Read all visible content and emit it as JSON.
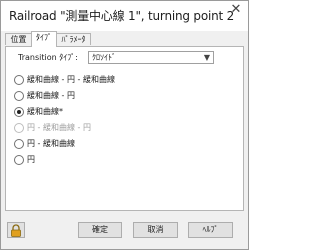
{
  "window": {
    "title": "Railroad \"測量中心線 1\", turning point 2",
    "close_glyph": "✕"
  },
  "tabs": [
    {
      "label": "位置"
    },
    {
      "label": "ﾀｲﾌﾟ"
    },
    {
      "label": "ﾊﾟﾗﾒｰﾀ"
    }
  ],
  "active_tab": 1,
  "type_tab": {
    "transition_label": "Transition ﾀｲﾌﾟ:",
    "transition_value": "ｸﾛｿｲﾄﾞ",
    "options": [
      {
        "label": "緩和曲線 - 円 - 緩和曲線",
        "checked": false,
        "disabled": false
      },
      {
        "label": "緩和曲線 - 円",
        "checked": false,
        "disabled": false
      },
      {
        "label": "緩和曲線*",
        "checked": true,
        "disabled": false
      },
      {
        "label": "円 - 緩和曲線 - 円",
        "checked": false,
        "disabled": true
      },
      {
        "label": "円 - 緩和曲線",
        "checked": false,
        "disabled": false
      },
      {
        "label": "円",
        "checked": false,
        "disabled": false
      }
    ]
  },
  "footer": {
    "ok_label": "確定",
    "cancel_label": "取消",
    "help_label": "ﾍﾙﾌﾟ",
    "lock_icon": "lock-icon",
    "lock_color": "#e0a020"
  }
}
